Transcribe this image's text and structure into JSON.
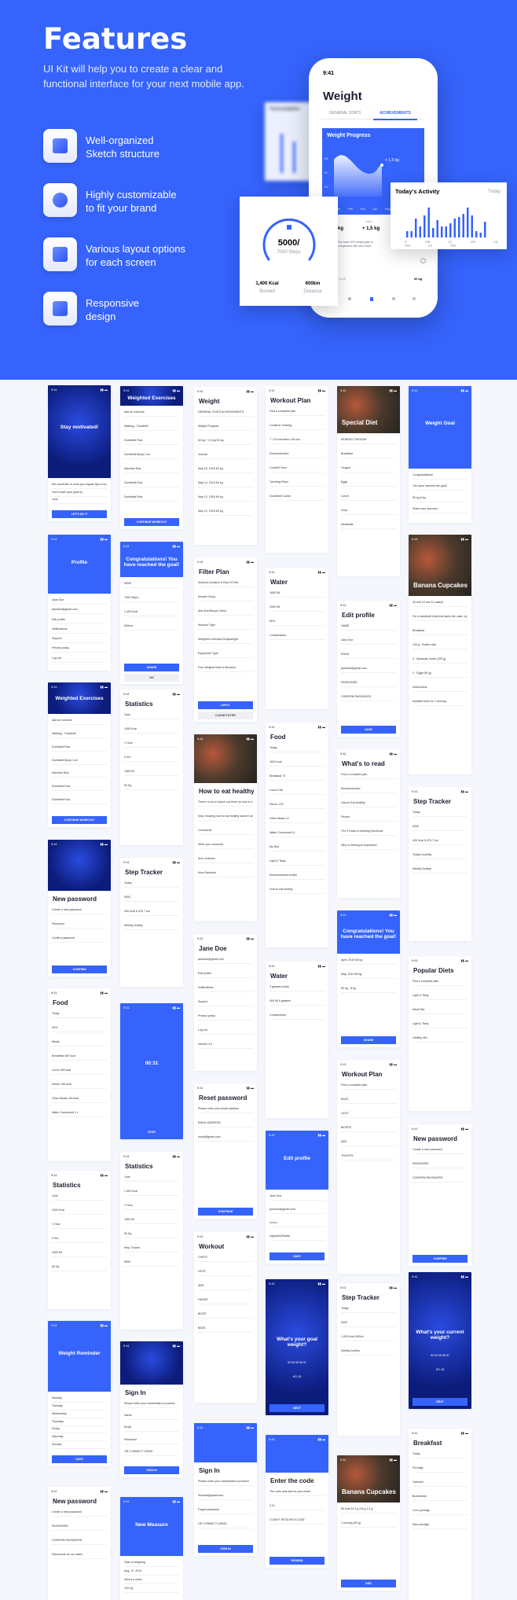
{
  "hero": {
    "title": "Features",
    "subtitle_line1": "UI Kit will help you to create a clear and",
    "subtitle_line2": "functional interface for your next mobile app.",
    "features": [
      {
        "icon": "layers-icon",
        "line1": "Well-organized",
        "line2": "Sketch structure"
      },
      {
        "icon": "stars-icon",
        "line1": "Highly customizable",
        "line2": "to fit your brand"
      },
      {
        "icon": "phones-icon",
        "line1": "Various layout options",
        "line2": "for each screen"
      },
      {
        "icon": "resize-icon",
        "line1": "Responsive",
        "line2": "design"
      }
    ],
    "phone": {
      "time": "9:41",
      "title": "Weight",
      "tabs": [
        "GENERAL STATS",
        "ACHIEVEMENTS"
      ],
      "active_tab": "ACHIEVEMENTS",
      "progress_title": "Weight Progress",
      "y_ticks": [
        "65",
        "60",
        "55",
        "50"
      ],
      "months": [
        "Jan",
        "Feb",
        "Mar",
        "Apr",
        "May"
      ],
      "gain_label": "+ 1,5 kg",
      "stat_gain_label": "Gain",
      "stat_gain": "+ 1,5 kg",
      "stat_weight": "kg",
      "note": "You have 10% weight gain in comparison with last month",
      "journal_date": "2018",
      "journal_value": "60 kg"
    },
    "steps_card": {
      "value": "5000/",
      "sub": "7000 Steps",
      "kcal": "1,400 Kcal",
      "kcal_label": "Burned",
      "distance": "600km",
      "distance_label": "Distance"
    },
    "activity_card": {
      "title": "Today's Activity",
      "filter": "Today",
      "times": [
        "6 AM",
        "11 AM",
        "16 PM",
        "22 PM"
      ]
    },
    "blurred_card": {
      "title": "Consumption"
    }
  },
  "colors": {
    "accent": "#3563fb",
    "background": "#f5f7fc",
    "text": "#1a1d2c"
  },
  "screens": [
    {
      "title": "Stay motivated!",
      "lines": [
        "We would like to send you regular tips to increase your win way",
        "You'll reach your goal by",
        "June"
      ],
      "button": "LET'S DO IT"
    },
    {
      "title": "Profile",
      "lines": [
        "Jane Doe",
        "janedoe@gmail.com",
        "Edit profile",
        "Notifications",
        "Support",
        "Privacy policy",
        "Log out"
      ]
    },
    {
      "title": "Weighted Exercises",
      "lines": [
        "Add an exercise",
        "Walking - Treadmill",
        "Dumbbell Row",
        "Dumbbell Bicep Curl",
        "Machine Row",
        "Dumbbell Row",
        "Dumbbell Row"
      ],
      "button": "CONTINUE WORKOUT"
    },
    {
      "title": "New password",
      "lines": [
        "Create a new password",
        "Password",
        "Confirm password"
      ],
      "button": "CONFIRM"
    },
    {
      "title": "Food",
      "lines": [
        "Today",
        "40%",
        "Meals",
        "Breakfast 450 kcal",
        "Lunch 450 kcal",
        "Dinner 450 kcal",
        "Other Meals 450 kcal",
        "Water Consumed 1 L"
      ]
    },
    {
      "title": "Statistics",
      "lines": [
        "June",
        "1000 Kcal",
        "1 Hour",
        "5 Km",
        "1500 Ml",
        "60 Kg"
      ]
    },
    {
      "title": "Weight Reminder",
      "lines": [
        "Monday",
        "Tuesday",
        "Wednesday",
        "Thursday",
        "Friday",
        "Saturday",
        "Sunday"
      ],
      "button": "SAVE"
    },
    {
      "title": "New password",
      "lines": [
        "Create a new password",
        "PASSWORD",
        "CONFIRM PASSWORD",
        "Passwords do not match"
      ]
    },
    {
      "title": "Weighted Exercises",
      "lines": [
        "Add an exercise",
        "Walking - Treadmill",
        "Dumbbell Row",
        "Dumbbell Bicep Curl",
        "Machine Row",
        "Dumbbell Row",
        "Dumbbell Row"
      ],
      "button": "CONTINUE WORKOUT"
    },
    {
      "title": "Congratulations! You have reached the goal!",
      "lines": [
        "5000/",
        "7000 Steps",
        "1,400 Kcal",
        "600km"
      ],
      "button": "SHARE",
      "button2": "OK"
    },
    {
      "title": "Statistics",
      "lines": [
        "June",
        "1000 Kcal",
        "1 Hour",
        "5 Km",
        "1500 Ml",
        "60 Kg"
      ]
    },
    {
      "title": "Step Tracker",
      "lines": [
        "Today",
        "5000",
        "400 Kcal  6,376  7 km",
        "Weekly Activity"
      ]
    },
    {
      "title": "00:31",
      "lines": [],
      "button": "STOP"
    },
    {
      "title": "Statistics",
      "lines": [
        "June",
        "1,400 Kcal",
        "1 Hour",
        "1500 Ml",
        "60 Kg",
        "Step Tracker",
        "5000"
      ]
    },
    {
      "title": "Sign In",
      "lines": [
        "Please enter your credentials to proceed",
        "Name",
        "Email",
        "Password",
        "OR CONNECT USING"
      ],
      "button": "SIGN IN"
    },
    {
      "title": "New Measure",
      "lines": [
        "Date of weighing",
        "Aug. 17, 2019",
        "Select a value",
        "120 Kg"
      ]
    },
    {
      "title": "Weight",
      "lines": [
        "GENERAL STATS   ACHIEVEMENTS",
        "Weight Progress",
        "60 kg   + 1,5 kg   50 kg",
        "Journal",
        "May 15, 2018   60 kg",
        "May 14, 2018   60 kg",
        "May 13, 2018   60 kg",
        "May 12, 2018   60 kg"
      ]
    },
    {
      "title": "Filter Plan",
      "lines": [
        "Workout Duration   5 Hour 20 Min",
        "Muscle Group",
        "Abs  Butt  Biceps  Chest",
        "Workout Type",
        "Weighted exercises  Bodyweight",
        "Equipment Type",
        "Free Weights  Bars & Benches"
      ],
      "button": "APPLY",
      "button2": "CLEAR FILTER"
    },
    {
      "title": "How to eat healthy",
      "lines": [
        "There's a lot of advice out there on how to eat healthy, and if we're being honest, it can sometimes feel like too much to think about.",
        "Now, knowing how to eat healthy doesn't seem quite so straightforward.",
        "Comments",
        "Write your comment",
        "Kris Lindholm",
        "Nora Santoroli"
      ]
    },
    {
      "title": "Jane Doe",
      "lines": [
        "janedoe@gmail.com",
        "Edit profile",
        "Notifications",
        "Support",
        "Privacy policy",
        "Log out",
        "Version 4.0"
      ]
    },
    {
      "title": "Reset password",
      "lines": [
        "Please enter your email address.",
        "EMAIL ADDRESS",
        "email@gmail.com"
      ],
      "button": "CONTINUE"
    },
    {
      "title": "Workout",
      "lines": [
        "CHEST",
        "LEGS",
        "ABS",
        "HANDS",
        "BICEP",
        "BACK"
      ]
    },
    {
      "title": "Sign In",
      "lines": [
        "Please enter your credentials to proceed",
        "finnuwa@gmail.com",
        "Forgot password",
        "OR CONNECT USING"
      ],
      "button": "SIGN IN"
    },
    {
      "title": "Workout Plan",
      "lines": [
        "Find a complete plan",
        "Continue Training",
        "7 / 10 exercises • 60 min",
        "Recommended",
        "CrossFit Hero",
        "Trending Plans",
        "Dumbbell Cardio"
      ]
    },
    {
      "title": "Water",
      "lines": [
        "1800 ML",
        "2000 ML",
        "80%",
        "Consumption"
      ]
    },
    {
      "title": "Food",
      "lines": [
        "Today",
        "1623 kcal",
        "Breakfast 74",
        "Lunch 156",
        "Dinner 120",
        "Other Meals 12",
        "Water Consumed 1L",
        "My Diet",
        "Light & Tasty",
        "Recommended Article",
        "How to eat healthy"
      ]
    },
    {
      "title": "Water",
      "lines": [
        "4 glasses today",
        "400 Ml   8 glasses",
        "Consumption"
      ]
    },
    {
      "title": "Edit profile",
      "lines": [
        "Jane Doe",
        "janedoe@gmail.com",
        "••••••••",
        "sdgufahsf3owhd"
      ],
      "button": "SAVE"
    },
    {
      "title": "What's your goal weight?",
      "lines": [
        "53  54  55  56  57",
        "KG  LB"
      ],
      "button": "NEXT"
    },
    {
      "title": "Enter the code",
      "lines": [
        "The code was sent to your email",
        "3   8   |",
        "I DIDN'T RECEIVE A CODE"
      ],
      "button": "RESEND"
    },
    {
      "title": "Special Diet",
      "lines": [
        "MONDAY  TUESDAY",
        "Breakfast",
        "Yougurt",
        "Eggs",
        "Lunch",
        "Soup",
        "Meatballs"
      ]
    },
    {
      "title": "Edit profile",
      "lines": [
        "NAME",
        "Jane Doe",
        "EMAIL",
        "janedoe@gmail.com",
        "PASSWORD",
        "CONFIRM PASSWORD"
      ],
      "button": "SAVE"
    },
    {
      "title": "What's to read",
      "lines": [
        "Find a complete plan",
        "Recommended",
        "How to Eat Healthy",
        "Recent",
        "The 5 Rules of Morning Workouts",
        "Why is training so important?"
      ]
    },
    {
      "title": "Congratulations! You have reached the goal!",
      "lines": [
        "April, 2019   66 kg",
        "May, 2019   66 kg",
        "60 kg    - 6 kg"
      ],
      "button": "SHARE"
    },
    {
      "title": "Workout Plan",
      "lines": [
        "Find a complete plan",
        "BACK",
        "LEGS",
        "BICEPS",
        "ABS",
        "TRICEPS"
      ]
    },
    {
      "title": "Step Tracker",
      "lines": [
        "Today",
        "5000",
        "1,400 Kcal   600km",
        "Weekly Activity"
      ]
    },
    {
      "title": "Banana Cupcakes",
      "lines": [
        "60 kcal  12.4 g  3.8 g  1.4 g",
        "1   serving (50 g)"
      ],
      "button": "ADD"
    },
    {
      "title": "Weight Goal",
      "lines": [
        "Congratulations!",
        "You have reached the goal!",
        "50 kg     6 kg",
        "Share your success"
      ]
    },
    {
      "title": "Banana Cupcakes",
      "lines": [
        "40 min   10 min   12 makes",
        "For a handheld treat that takes the cake, try these cute confections.",
        "Breakfast",
        "100 g · Rolled oats",
        "3 · Bananas, small (225 g)",
        "2 · Eggs (60 g)",
        "Instructions",
        "Nutrition facts for 1 serving"
      ]
    },
    {
      "title": "Step Tracker",
      "lines": [
        "Today",
        "5000",
        "400 Kcal  6,376  7 km",
        "Today's Activity",
        "Weekly Activity"
      ]
    },
    {
      "title": "Popular Diets",
      "lines": [
        "Find a complete plan",
        "Light & Tasty",
        "Meat Diet",
        "Light & Tasty",
        "Healthy Mix"
      ]
    },
    {
      "title": "New password",
      "lines": [
        "Create a new password",
        "PASSWORD",
        "CONFIRM PASSWORD"
      ],
      "button": "CONFIRM"
    },
    {
      "title": "What's your current weight?",
      "lines": [
        "53  54  55  56  57",
        "KG  LB"
      ],
      "button": "NEXT"
    },
    {
      "title": "Breakfast",
      "lines": [
        "Today",
        "Porridge",
        "Oatmeal",
        "Buckwheat",
        "Corn porridge",
        "Rice porridge"
      ]
    }
  ]
}
